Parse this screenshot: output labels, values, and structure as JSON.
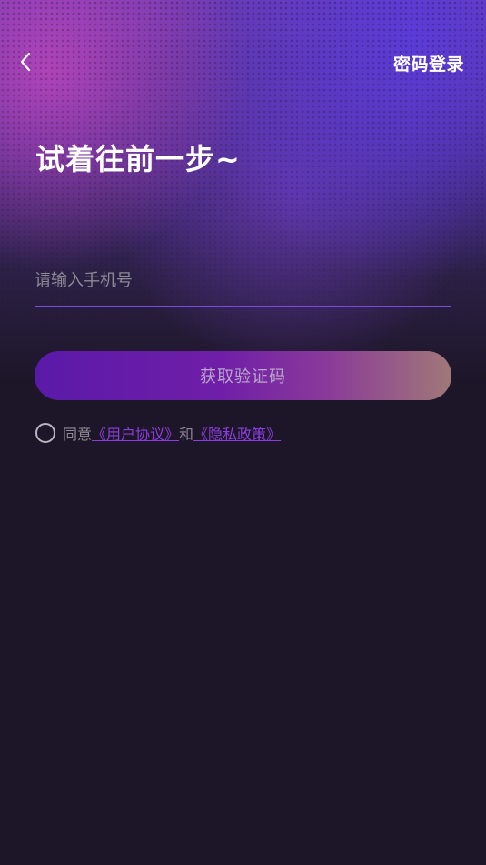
{
  "header": {
    "back_icon": "chevron-left-icon",
    "password_login_label": "密码登录"
  },
  "main": {
    "headline": "试着往前一步~",
    "phone_input": {
      "placeholder": "请输入手机号",
      "value": ""
    },
    "get_code_button_label": "获取验证码"
  },
  "agreement": {
    "checked": false,
    "prefix": "同意",
    "user_agreement_link": "《用户协议》",
    "connector": "和",
    "privacy_policy_link": "《隐私政策》"
  },
  "colors": {
    "accent": "#7b4be0",
    "link": "#8c3ee0",
    "background": "#1d1628"
  }
}
